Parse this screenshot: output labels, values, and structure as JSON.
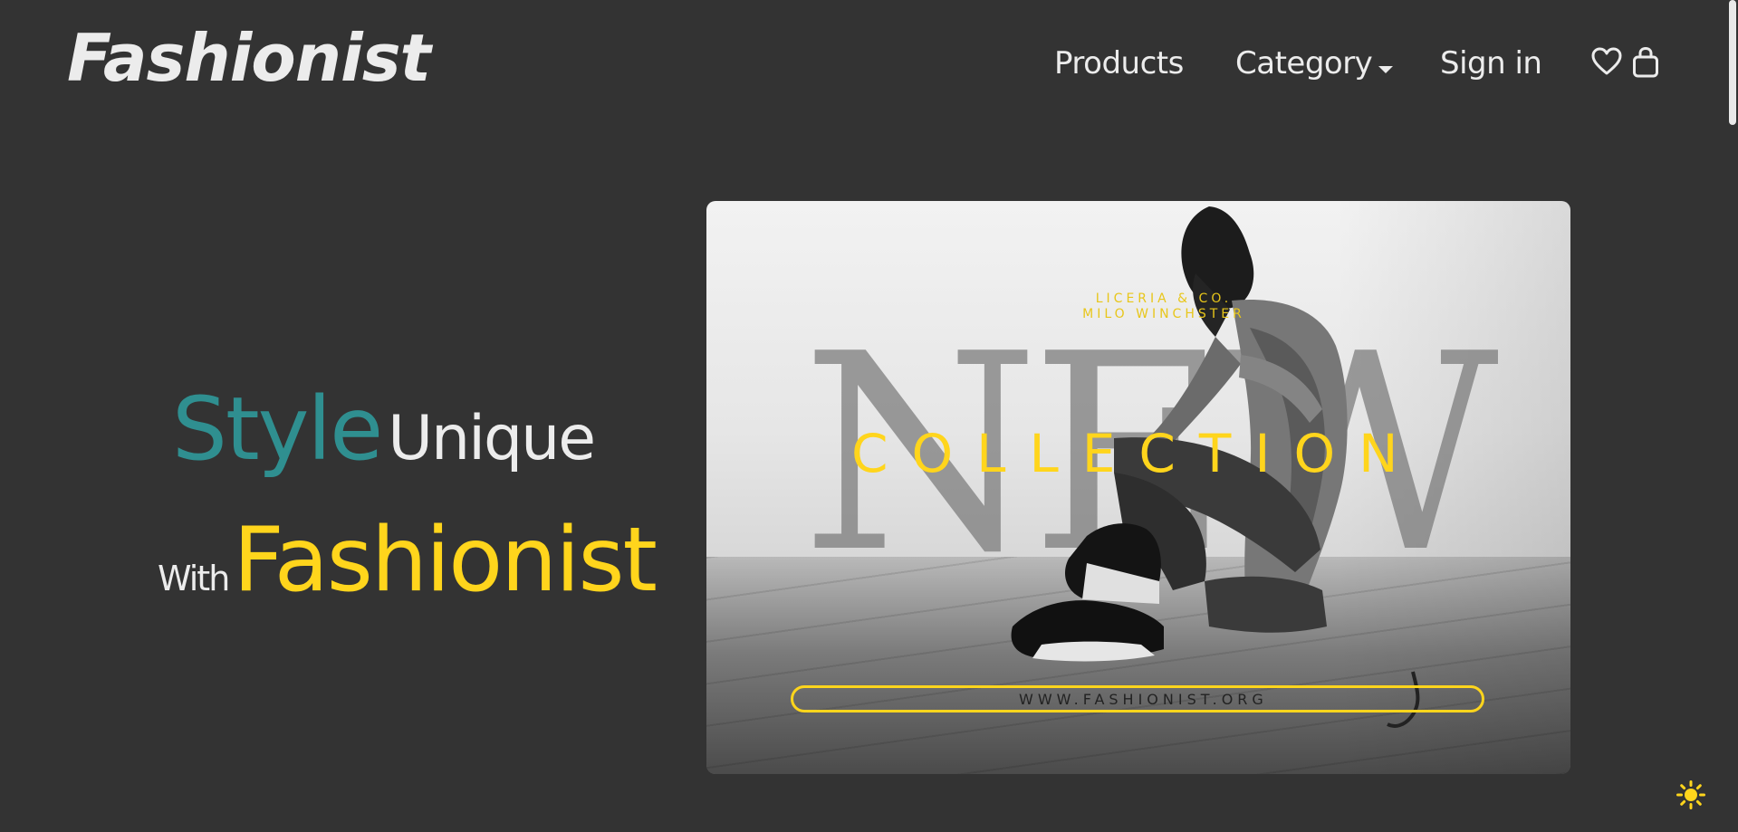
{
  "header": {
    "logo": "Fashionist",
    "nav": {
      "products": "Products",
      "category": "Category",
      "signin": "Sign in"
    },
    "icons": [
      "heart-icon",
      "shopping-bag-icon"
    ]
  },
  "hero": {
    "line1": {
      "word1": "Style",
      "word2": "Unique"
    },
    "line2": {
      "word1": "With",
      "word2": "Fashionist"
    }
  },
  "banner": {
    "brand_line1": "LICERIA & CO.",
    "brand_line2": "MILO WINCHSTER",
    "big_word": "NEW",
    "collection": "COLLECTION",
    "url": "WWW.FASHIONIST.ORG"
  },
  "theme_toggle_icon": "sun-icon",
  "colors": {
    "background": "#333333",
    "teal": "#2f8f90",
    "yellow": "#ffd51c",
    "text": "#ececec"
  }
}
